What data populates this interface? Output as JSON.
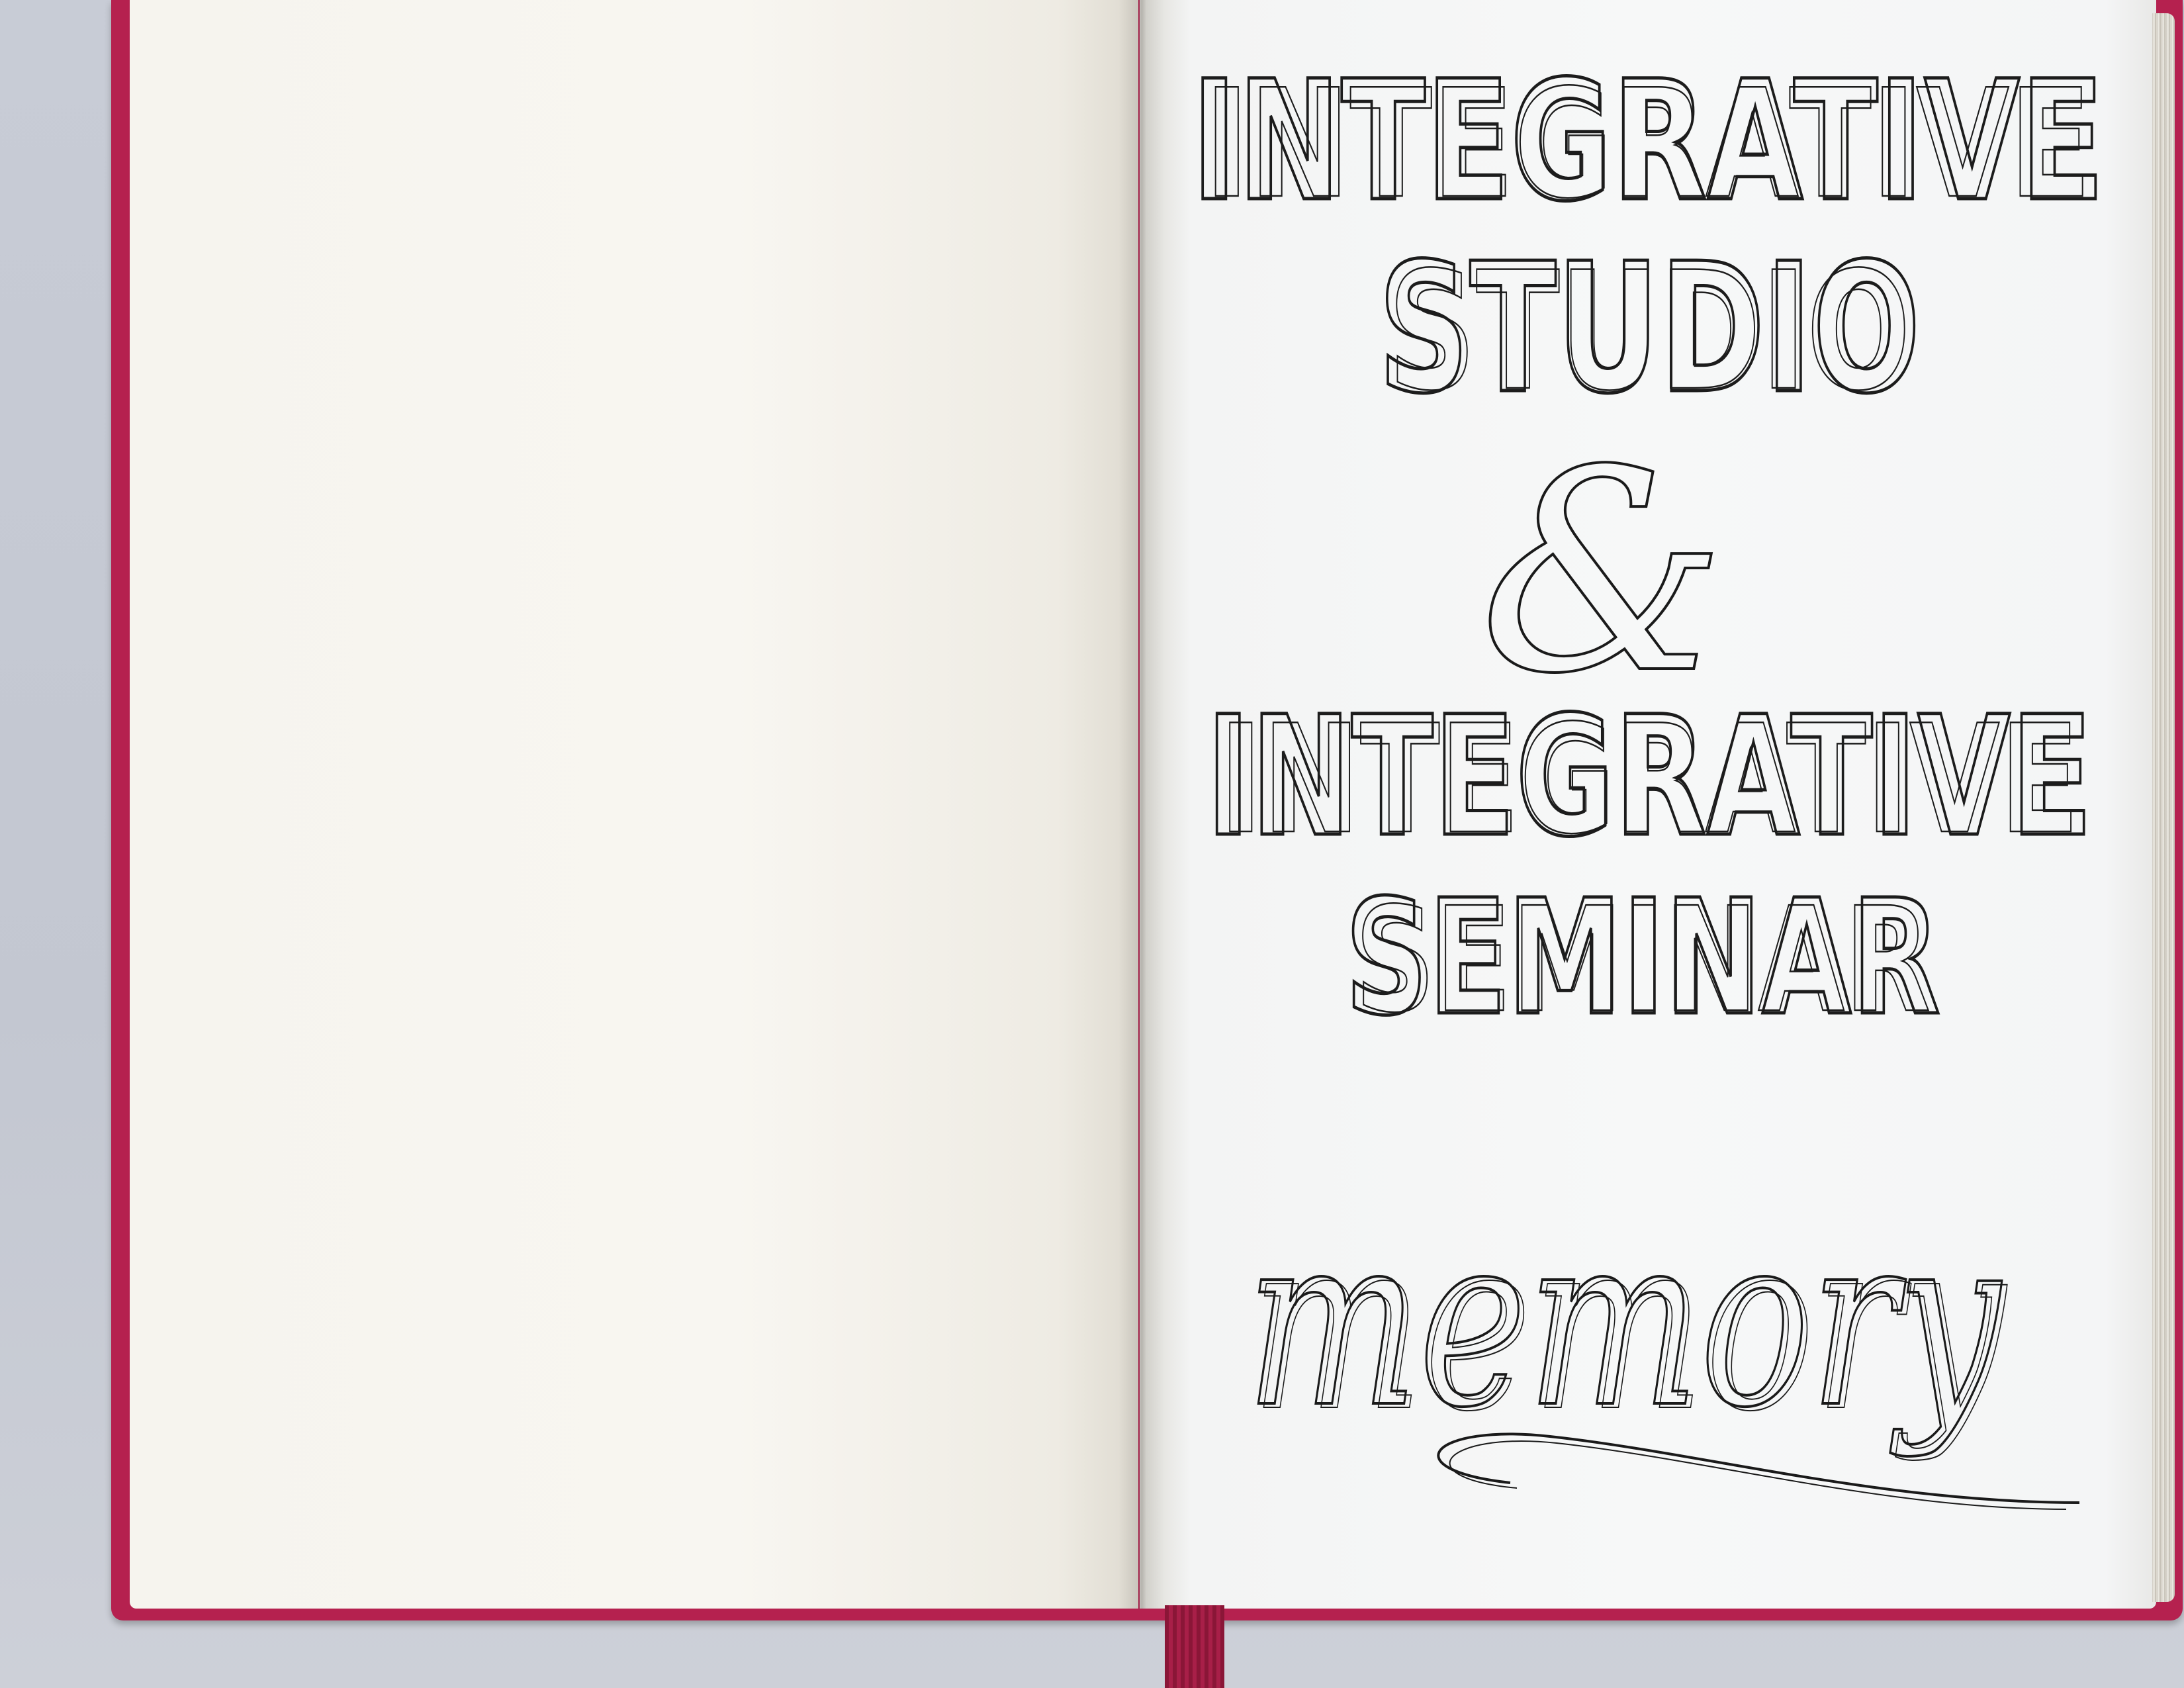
{
  "notebook": {
    "title_line_1": "INTEGRATIVE",
    "title_line_2": "STUDIO",
    "ampersand": "&",
    "title_line_3": "INTEGRATIVE",
    "title_line_4": "SEMINAR",
    "script_word": "memory"
  },
  "colors": {
    "cover": "#b5214f",
    "ink": "#1c1c1c",
    "paper": "#f7f8f8"
  }
}
